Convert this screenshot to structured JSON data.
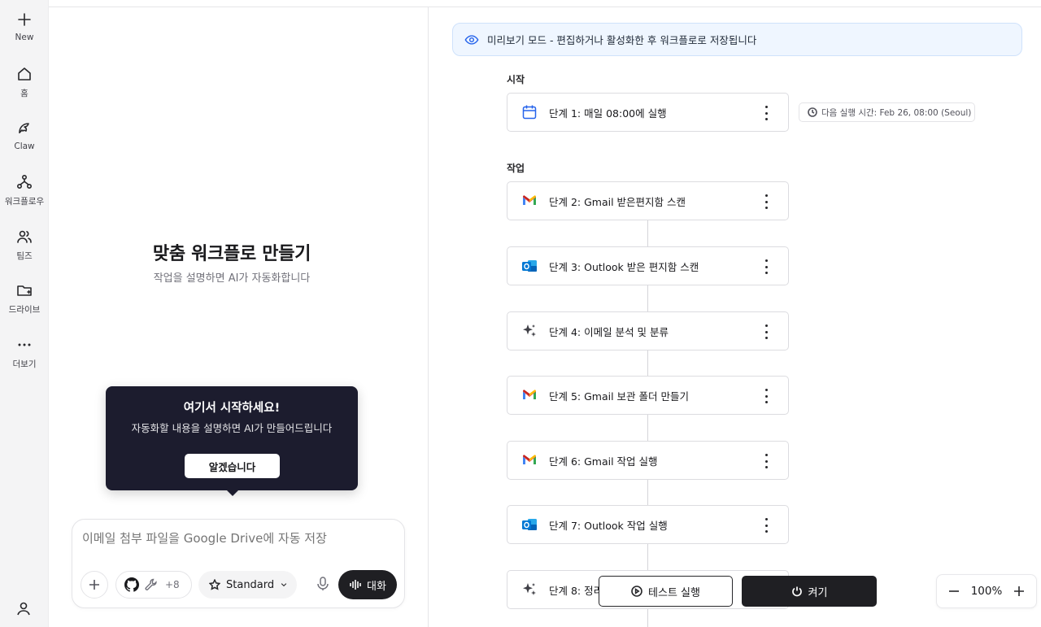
{
  "sidebar": {
    "items": [
      {
        "label": "New",
        "icon": "plus-icon"
      },
      {
        "label": "홈",
        "icon": "home-icon"
      },
      {
        "label": "Claw",
        "icon": "claw-icon"
      },
      {
        "label": "워크플로우",
        "icon": "workflow-icon"
      },
      {
        "label": "팀즈",
        "icon": "users-icon"
      },
      {
        "label": "드라이브",
        "icon": "folder-icon"
      },
      {
        "label": "더보기",
        "icon": "more-icon"
      }
    ],
    "profile_icon": "user-icon"
  },
  "left": {
    "title": "맞춤 워크플로 만들기",
    "subtitle": "작업을 설명하면 AI가 자동화합니다",
    "tooltip": {
      "title": "여기서 시작하세요!",
      "description": "자동화할 내용을 설명하면 AI가 만들어드립니다",
      "button": "알겠습니다"
    },
    "composer": {
      "placeholder": "이메일 첨부 파일을 Google Drive에 자동 저장",
      "tools_count": "+8",
      "mode_label": "Standard",
      "talk_label": "대화"
    }
  },
  "right": {
    "banner": "미리보기 모드 - 편집하거나 활성화한 후 워크플로로 저장됩니다",
    "start_label": "시작",
    "tasks_label": "작업",
    "next_run": "다음 실행 시간: Feb 26, 08:00 (Seoul)",
    "steps": [
      {
        "label": "단계 1: 매일 08:00에 실행",
        "icon": "calendar-icon"
      },
      {
        "label": "단계 2: Gmail 받은편지함 스캔",
        "icon": "gmail-icon"
      },
      {
        "label": "단계 3: Outlook 받은 편지함 스캔",
        "icon": "outlook-icon"
      },
      {
        "label": "단계 4: 이메일 분석 및 분류",
        "icon": "sparkle-icon"
      },
      {
        "label": "단계 5: Gmail 보관 폴더 만들기",
        "icon": "gmail-icon"
      },
      {
        "label": "단계 6: Gmail 작업 실행",
        "icon": "gmail-icon"
      },
      {
        "label": "단계 7: Outlook 작업 실행",
        "icon": "outlook-icon"
      },
      {
        "label": "단계 8: 정리",
        "icon": "sparkle-icon"
      }
    ],
    "test_button": "테스트 실행",
    "power_button": "켜기",
    "zoom": "100%"
  },
  "colors": {
    "accent_blue": "#2563eb",
    "banner_bg": "#eff6ff",
    "dark": "#1f1f23",
    "tooltip_bg": "#1c1c2e",
    "sidebar_bg": "#f4f4f5"
  }
}
